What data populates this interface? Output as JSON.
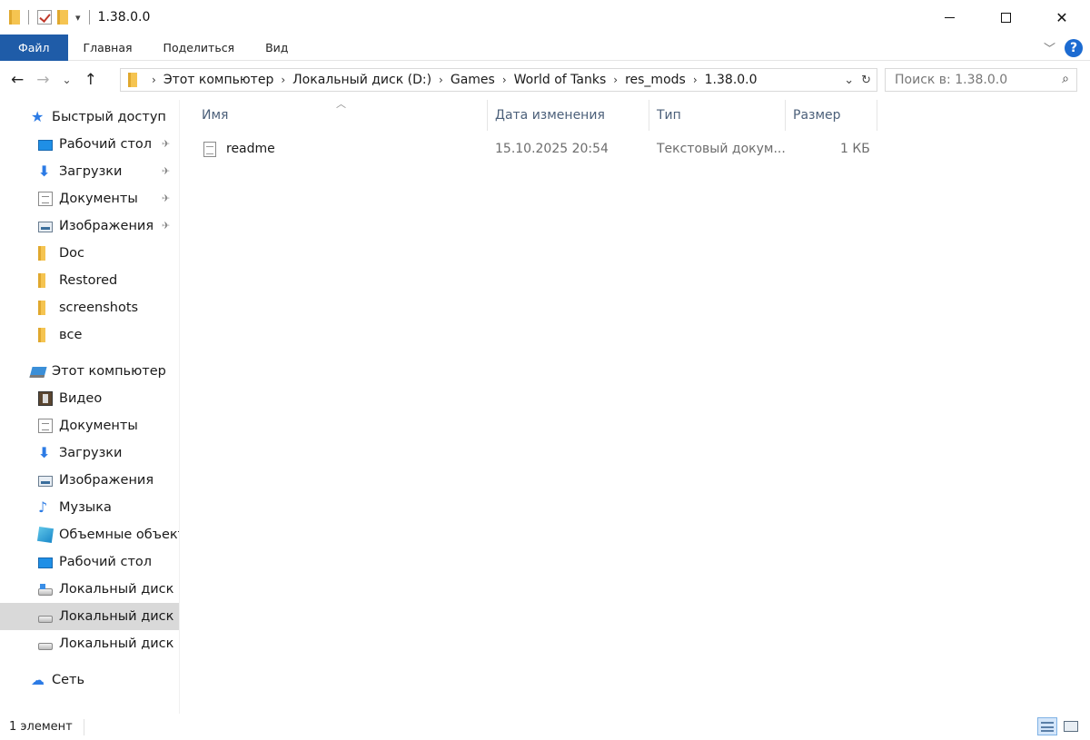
{
  "window": {
    "title": "1.38.0.0",
    "controls": {
      "minimize": "minimize",
      "maximize": "maximize",
      "close": "✕"
    }
  },
  "ribbon": {
    "tabs": [
      "Файл",
      "Главная",
      "Поделиться",
      "Вид"
    ],
    "help_label": "?"
  },
  "address": {
    "crumbs": [
      "Этот компьютер",
      "Локальный диск (D:)",
      "Games",
      "World of Tanks",
      "res_mods",
      "1.38.0.0"
    ],
    "search_placeholder": "Поиск в: 1.38.0.0"
  },
  "sidebar": {
    "quick_access": "Быстрый доступ",
    "quick_items": [
      {
        "label": "Рабочий стол",
        "icon": "desktop-icon",
        "pinned": true
      },
      {
        "label": "Загрузки",
        "icon": "downloads-icon",
        "pinned": true
      },
      {
        "label": "Документы",
        "icon": "documents-icon",
        "pinned": true
      },
      {
        "label": "Изображения",
        "icon": "pictures-icon",
        "pinned": true
      },
      {
        "label": "Doc",
        "icon": "folder-icon",
        "pinned": false
      },
      {
        "label": "Restored",
        "icon": "folder-icon",
        "pinned": false
      },
      {
        "label": "screenshots",
        "icon": "folder-icon",
        "pinned": false
      },
      {
        "label": "все",
        "icon": "folder-icon",
        "pinned": false
      }
    ],
    "this_pc": "Этот компьютер",
    "pc_items": [
      {
        "label": "Видео",
        "icon": "video-icon"
      },
      {
        "label": "Документы",
        "icon": "documents-icon"
      },
      {
        "label": "Загрузки",
        "icon": "downloads-icon"
      },
      {
        "label": "Изображения",
        "icon": "pictures-icon"
      },
      {
        "label": "Музыка",
        "icon": "music-icon"
      },
      {
        "label": "Объемные объекты",
        "icon": "3d-objects-icon"
      },
      {
        "label": "Рабочий стол",
        "icon": "desktop-icon"
      },
      {
        "label": "Локальный диск (C:)",
        "icon": "system-drive-icon"
      },
      {
        "label": "Локальный диск (D:)",
        "icon": "drive-icon",
        "active": true
      },
      {
        "label": "Локальный диск (E:)",
        "icon": "drive-icon"
      }
    ],
    "network": "Сеть"
  },
  "columns": {
    "name": "Имя",
    "modified": "Дата изменения",
    "type": "Тип",
    "size": "Размер"
  },
  "files": [
    {
      "name": "readme",
      "modified": "15.10.2025 20:54",
      "type": "Текстовый докум...",
      "size": "1 КБ"
    }
  ],
  "status": {
    "count": "1 элемент"
  },
  "colors": {
    "file_tab": "#1f5ca8",
    "header_text": "#4c607a",
    "selected_nav": "#d9d9d9"
  }
}
